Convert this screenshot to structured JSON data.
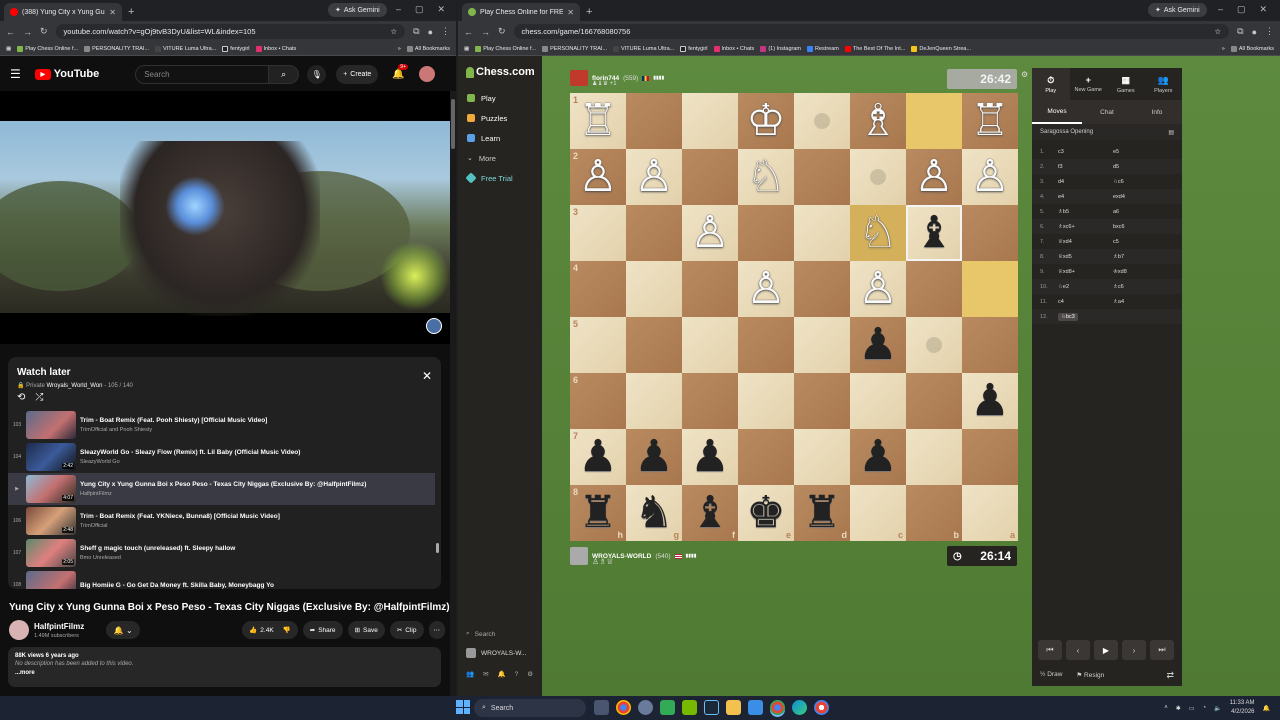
{
  "left_browser": {
    "tab_title": "(388) Yung City x Yung Gunn",
    "ask_gemini": "Ask Gemini",
    "url": "youtube.com/watch?v=gOj9tvB3DyU&list=WL&index=105",
    "bookmarks": [
      "Play Chess Online f...",
      "PERSONALITY TRAI...",
      "VITURE Luma Ultra...",
      "fentygirl",
      "Inbox • Chats"
    ],
    "all_bookmarks": "All Bookmarks"
  },
  "youtube": {
    "logo": "YouTube",
    "search_placeholder": "Search",
    "create": "Create",
    "notif_count": "9+",
    "playlist": {
      "title": "Watch later",
      "privacy": "Private",
      "owner": "Wroyals_World_Won",
      "position": "105 / 140",
      "items": [
        {
          "num": "103",
          "title": "Trim - Boat Remix (Feat. Pooh Shiesty) [Official Music Video]",
          "channel": "TrimOfficial and Pooh Shiesty",
          "dur": ""
        },
        {
          "num": "104",
          "title": "SleazyWorld Go - Sleazy Flow (Remix) ft. Lil Baby (Official Music Video)",
          "channel": "SleazyWorld Go",
          "dur": "2:42"
        },
        {
          "num": "▶",
          "title": "Yung City x Yung Gunna Boi x Peso Peso - Texas City Niggas (Exclusive By: @HalfpintFilmz)",
          "channel": "HalfpintFilmz",
          "dur": "4:07"
        },
        {
          "num": "106",
          "title": "Trim - Boat Remix (Feat. YKNiece, Bunna8) [Official Music Video]",
          "channel": "TrimOfficial",
          "dur": "2:48"
        },
        {
          "num": "107",
          "title": "Sheff g magic touch (unreleased) ft. Sleepy hallow",
          "channel": "Bmo Unreleased",
          "dur": "2:05"
        },
        {
          "num": "108",
          "title": "Big Homiie G - Go Get Da Money ft. Skilla Baby, Moneybagg Yo",
          "channel": "",
          "dur": ""
        }
      ]
    },
    "video_title": "Yung City x Yung Gunna Boi x Peso Peso - Texas City Niggas (Exclusive By: @HalfpintFilmz)",
    "channel_name": "HalfpintFilmz",
    "subscribers": "1.49M subscribers",
    "likes": "2.4K",
    "share": "Share",
    "save": "Save",
    "clip": "Clip",
    "views": "88K views  6 years ago",
    "description": "No description has been added to this video.",
    "more": "...more"
  },
  "right_browser": {
    "tab_title": "Play Chess Online for FREE - 2 |",
    "ask_gemini": "Ask Gemini",
    "url": "chess.com/game/166768080756",
    "bookmarks": [
      "Play Chess Online f...",
      "PERSONALITY TRAI...",
      "VITURE Luma Ultra...",
      "fentygirl",
      "Inbox • Chats",
      "(1) Instagram",
      "Restream",
      "The Best Of The Int...",
      "DeJenQueen Strea..."
    ],
    "all_bookmarks": "All Bookmarks"
  },
  "chess": {
    "logo": "Chess.com",
    "nav": [
      "Play",
      "Puzzles",
      "Learn",
      "More",
      "Free Trial"
    ],
    "nav_colors": [
      "#81b64c",
      "#f0a93b",
      "#5aa0e6",
      "#aaaaaa",
      "#55c2c2"
    ],
    "search": "Search",
    "profile": "WROYALS-W...",
    "opponent": {
      "name": "florin744",
      "rating": "(559)",
      "captures": "♟♝♛ +1"
    },
    "player": {
      "name": "WROYALS-WORLD",
      "rating": "(540)",
      "captures": "♙♗♕"
    },
    "clock_top": "26:42",
    "clock_bottom": "26:14",
    "files": [
      "h",
      "g",
      "f",
      "e",
      "d",
      "c",
      "b",
      "a"
    ],
    "ranks": [
      "1",
      "2",
      "3",
      "4",
      "5",
      "6",
      "7",
      "8"
    ],
    "tabs": [
      {
        "icon": "⏱",
        "label": "Play"
      },
      {
        "icon": "+",
        "label": "New Game"
      },
      {
        "icon": "▦",
        "label": "Games"
      },
      {
        "icon": "👥",
        "label": "Players"
      }
    ],
    "subtabs": [
      "Moves",
      "Chat",
      "Info"
    ],
    "opening": "Saragossa Opening",
    "moves": [
      {
        "n": "1.",
        "w": "c3",
        "b": "e5"
      },
      {
        "n": "2.",
        "w": "f3",
        "b": "d5"
      },
      {
        "n": "3.",
        "w": "d4",
        "b": "♘c6"
      },
      {
        "n": "4.",
        "w": "e4",
        "b": "exd4"
      },
      {
        "n": "5.",
        "w": "♗b5",
        "b": "a6"
      },
      {
        "n": "6.",
        "w": "♗xc6+",
        "b": "bxc6"
      },
      {
        "n": "7.",
        "w": "♕xd4",
        "b": "c5"
      },
      {
        "n": "8.",
        "w": "♕xd5",
        "b": "♗b7"
      },
      {
        "n": "9.",
        "w": "♕xd8+",
        "b": "♔xd8"
      },
      {
        "n": "10.",
        "w": "♘e2",
        "b": "♗c6"
      },
      {
        "n": "11.",
        "w": "c4",
        "b": "♗a4"
      },
      {
        "n": "12.",
        "w": "♘bc3",
        "b": ""
      }
    ],
    "draw": "Draw",
    "resign": "Resign"
  },
  "taskbar": {
    "search": "Search",
    "time": "11:33 AM",
    "date": "4/2/2026"
  }
}
